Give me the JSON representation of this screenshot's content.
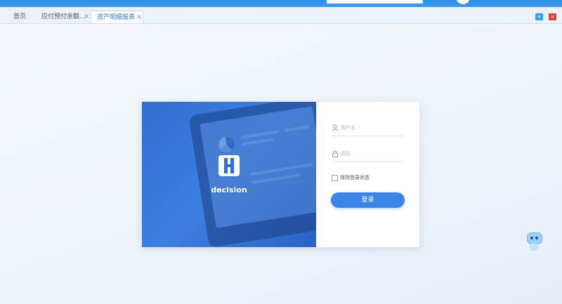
{
  "tabs": [
    {
      "label": "首页",
      "closable": false,
      "active": false
    },
    {
      "label": "应付预付余额...",
      "closable": true,
      "active": false
    },
    {
      "label": "资产明细报表",
      "closable": true,
      "active": true
    }
  ],
  "close_glyph": "×",
  "window_controls": {
    "minimize_icon": "chevron-down-icon",
    "close_icon": "close-icon",
    "close_glyph": "×",
    "minimize_color": "#3d9cf0",
    "close_color": "#e23b3b"
  },
  "brand": {
    "logo_text": "decision"
  },
  "login": {
    "username_placeholder": "用户名",
    "password_placeholder": "密码",
    "remember_label": "保持登录状态",
    "submit_label": "登录"
  },
  "colors": {
    "accent": "#3a86e8",
    "card_left": "#2e6fd1"
  }
}
